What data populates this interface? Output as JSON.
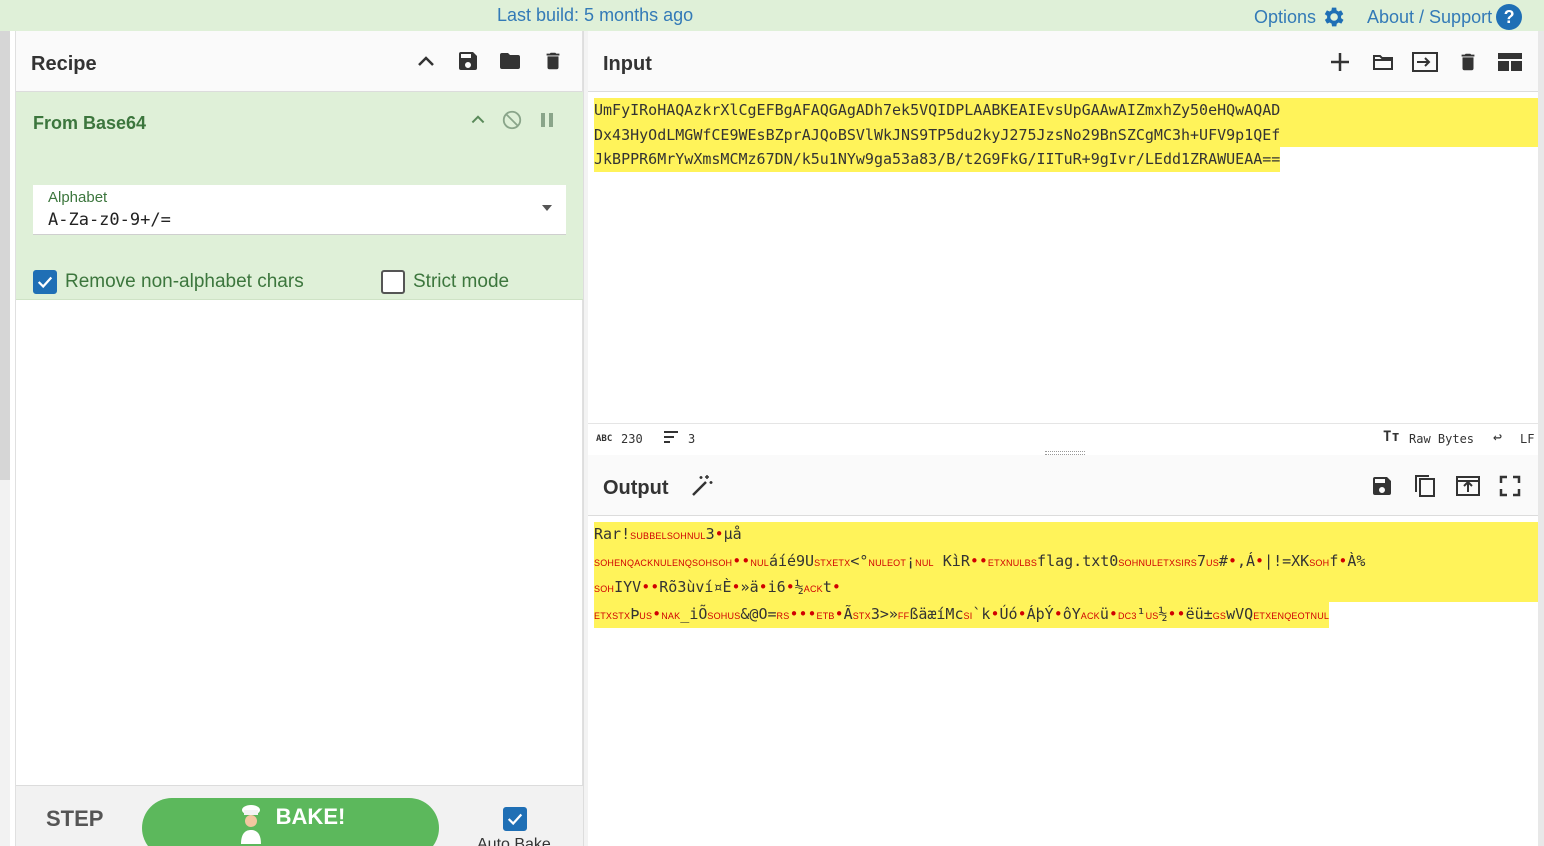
{
  "topbar": {
    "build": "Last build: 5 months ago",
    "options": "Options",
    "about": "About / Support"
  },
  "recipe": {
    "title": "Recipe",
    "operation": {
      "name": "From Base64",
      "alphabet_label": "Alphabet",
      "alphabet_value": "A-Za-z0-9+/=",
      "remove_nonalpha_label": "Remove non-alphabet chars",
      "remove_nonalpha_checked": true,
      "strict_label": "Strict mode",
      "strict_checked": false
    },
    "step_label": "STEP",
    "bake_label": "BAKE!",
    "autobake_label": "Auto Bake",
    "autobake_checked": true
  },
  "input": {
    "title": "Input",
    "lines": [
      "UmFyIRoHAQAzkrXlCgEFBgAFAQGAgADh7ek5VQIDPLAABKEAIEvsUpGAAwAIZmxhZy50eHQwAQAD",
      "Dx43HyOdLMGWfCE9WEsBZprAJQoBSVlWkJNS9TP5du2kyJ275JzsNo29BnSZCgMC3h+UFV9p1QEf",
      "JkBPPR6MrYwXmsMCMz67DN/k5u1NYw9ga53a83/B/t2G9FkG/IITuR+9gIvr/LEdd1ZRAWUEAA=="
    ],
    "char_count": "230",
    "line_count": "3",
    "raw_bytes": "Raw Bytes",
    "eol": "LF"
  },
  "output": {
    "title": "Output",
    "line1": [
      {
        "t": "Rar!"
      },
      {
        "c": "SUB"
      },
      {
        "c": "BEL"
      },
      {
        "c": "SOH"
      },
      {
        "c": "NUL"
      },
      {
        "t": "3"
      },
      {
        "d": "•"
      },
      {
        "t": "µå"
      }
    ],
    "line2": [
      {
        "c": "SOH"
      },
      {
        "c": "ENQ"
      },
      {
        "c": "ACK"
      },
      {
        "c": "NUL"
      },
      {
        "c": "ENQ"
      },
      {
        "c": "SOH"
      },
      {
        "c": "SOH"
      },
      {
        "d": "••"
      },
      {
        "c": "NUL"
      },
      {
        "t": "áíé9U"
      },
      {
        "c": "STX"
      },
      {
        "c": "ETX"
      },
      {
        "t": "<°"
      },
      {
        "c": "NUL"
      },
      {
        "c": "EOT"
      },
      {
        "t": "¡"
      },
      {
        "c": "NUL"
      },
      {
        "t": " KìR"
      },
      {
        "d": "••"
      },
      {
        "c": "ETX"
      },
      {
        "c": "NUL"
      },
      {
        "c": "BS"
      },
      {
        "t": "flag.txt0"
      },
      {
        "c": "SOH"
      },
      {
        "c": "NUL"
      },
      {
        "c": "ETX"
      },
      {
        "c": "SI"
      },
      {
        "c": "RS"
      },
      {
        "t": "7"
      },
      {
        "c": "US"
      },
      {
        "t": "#"
      },
      {
        "d": "•"
      },
      {
        "t": ",Á"
      },
      {
        "d": "•"
      },
      {
        "t": "|!=XK"
      },
      {
        "c": "SOH"
      },
      {
        "t": "f"
      },
      {
        "d": "•"
      },
      {
        "t": "À%"
      }
    ],
    "line3": [
      {
        "c": "SOH"
      },
      {
        "t": "IYV"
      },
      {
        "d": "••"
      },
      {
        "t": "Rõ3ùví¤È"
      },
      {
        "d": "•"
      },
      {
        "t": "»ä"
      },
      {
        "d": "•"
      },
      {
        "t": "i6"
      },
      {
        "d": "•"
      },
      {
        "t": "½"
      },
      {
        "c": "ACK"
      },
      {
        "t": "t"
      },
      {
        "d": "•"
      }
    ],
    "line4": [
      {
        "c": "ETX"
      },
      {
        "c": "STX"
      },
      {
        "t": "Þ"
      },
      {
        "c": "US"
      },
      {
        "d": "•"
      },
      {
        "c": "NAK"
      },
      {
        "t": "_iÕ"
      },
      {
        "c": "SOH"
      },
      {
        "c": "US"
      },
      {
        "t": "&@O="
      },
      {
        "c": "RS"
      },
      {
        "d": "•••"
      },
      {
        "c": "ETB"
      },
      {
        "d": "•"
      },
      {
        "t": "Ã"
      },
      {
        "c": "STX"
      },
      {
        "t": "3>»"
      },
      {
        "c": "FF"
      },
      {
        "t": "ßäæíMc"
      },
      {
        "c": "SI"
      },
      {
        "t": "`k"
      },
      {
        "d": "•"
      },
      {
        "t": "Úó"
      },
      {
        "d": "•"
      },
      {
        "t": "ÁþÝ"
      },
      {
        "d": "•"
      },
      {
        "t": "ôY"
      },
      {
        "c": "ACK"
      },
      {
        "t": "ü"
      },
      {
        "d": "•"
      },
      {
        "c": "DC3"
      },
      {
        "t": "¹"
      },
      {
        "c": "US"
      },
      {
        "t": "½"
      },
      {
        "d": "••"
      },
      {
        "t": "ëü±"
      },
      {
        "c": "GS"
      },
      {
        "t": "wVQ"
      },
      {
        "c": "ETX"
      },
      {
        "c": "ENQ"
      },
      {
        "c": "EOT"
      },
      {
        "c": "NUL"
      }
    ]
  },
  "icons": {
    "gear": "gear-icon",
    "help": "help-icon",
    "save": "save-icon",
    "folder": "folder-icon",
    "trash": "trash-icon",
    "wand": "magic-wand-icon"
  },
  "colors": {
    "banner_bg": "#dff0d8",
    "link": "#337ab7",
    "operation_bg": "#dff0d8",
    "operation_text": "#3c763d",
    "highlight": "#fff35a",
    "control_char": "#d00000",
    "bake": "#5cb85c",
    "checkbox": "#1f6fb5"
  }
}
